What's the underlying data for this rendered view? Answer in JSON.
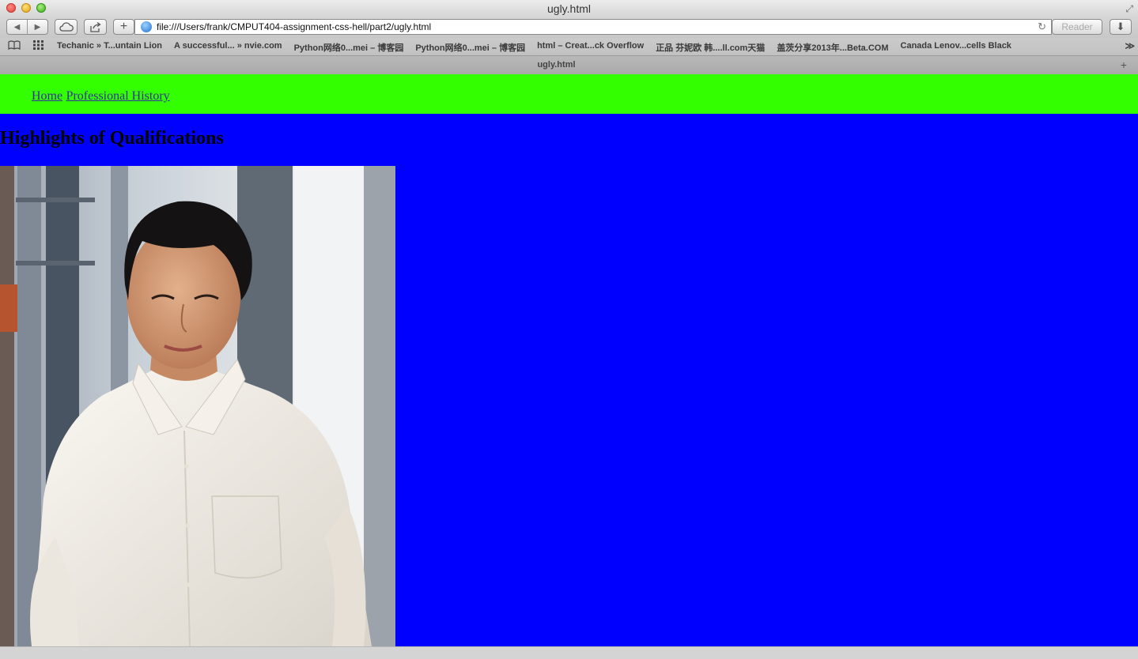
{
  "window": {
    "title": "ugly.html"
  },
  "toolbar": {
    "back_icon": "back-arrow-icon",
    "forward_icon": "forward-arrow-icon",
    "url": "file:///Users/frank/CMPUT404-assignment-css-hell/part2/ugly.html",
    "reader_label": "Reader"
  },
  "bookmarks": [
    "Techanic » T...untain Lion",
    "A successful... » nvie.com",
    "Python网络0...mei – 博客园",
    "Python网络0...mei – 博客园",
    "html – Creat...ck Overflow",
    "正品 芬妮欧 韩....ll.com天猫",
    "盖茨分享2013年...Beta.COM",
    "Canada Lenov...cells Black"
  ],
  "tab": {
    "label": "ugly.html"
  },
  "page": {
    "nav": {
      "home": "Home",
      "history": "Professional History"
    },
    "heading": "Highlights of Qualifications",
    "colors": {
      "navbar_bg": "#33ff00",
      "page_bg": "#0000ff",
      "link": "#333399"
    }
  }
}
